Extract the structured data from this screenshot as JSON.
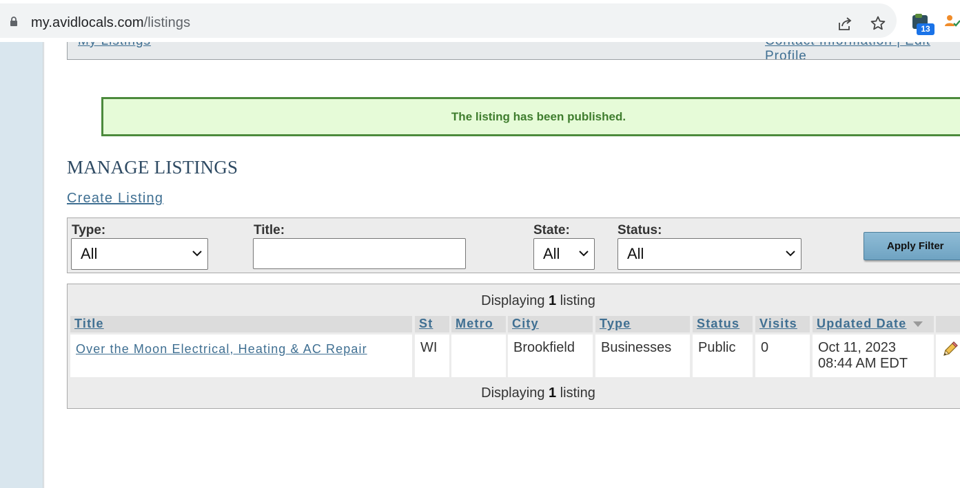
{
  "browser": {
    "url_host": "my.avidlocals.com",
    "url_path": "/listings",
    "extension_badge": "13"
  },
  "top_nav": {
    "left_link": "My Listings",
    "right_links": "Contact Information | Edit Profile"
  },
  "alert": {
    "message": "The listing has been published."
  },
  "page": {
    "title": "MANAGE LISTINGS",
    "create_link": "Create Listing"
  },
  "filters": {
    "type_label": "Type:",
    "type_value": "All",
    "title_label": "Title:",
    "title_value": "",
    "state_label": "State:",
    "state_value": "All",
    "status_label": "Status:",
    "status_value": "All",
    "apply_label": "Apply Filter"
  },
  "table": {
    "display_prefix": "Displaying ",
    "display_count": "1",
    "display_suffix": " listing",
    "columns": [
      "Title",
      "St",
      "Metro",
      "City",
      "Type",
      "Status",
      "Visits",
      "Updated Date"
    ],
    "rows": [
      {
        "title": "Over the Moon Electrical, Heating & AC Repair",
        "state": "WI",
        "metro": "",
        "city": "Brookfield",
        "type": "Businesses",
        "status": "Public",
        "visits": "0",
        "updated_date": "Oct 11, 2023",
        "updated_time": "08:44 AM EDT"
      }
    ]
  }
}
